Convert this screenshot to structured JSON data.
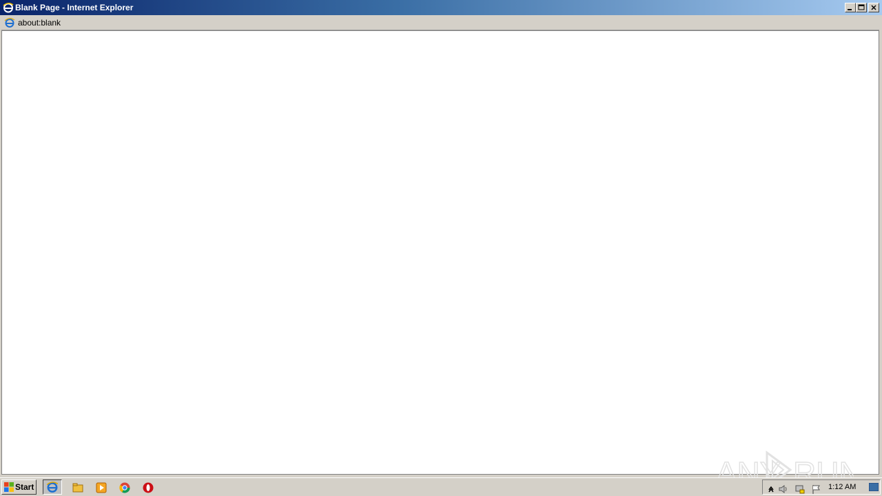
{
  "window": {
    "title": "Blank Page - Internet Explorer",
    "address": "about:blank",
    "controls": [
      "minimize",
      "maximize",
      "close"
    ]
  },
  "watermark": {
    "text": "ANY RUN"
  },
  "taskbar": {
    "start_label": "Start",
    "pinned": [
      "internet-explorer-icon",
      "file-explorer-icon",
      "media-player-icon",
      "chrome-icon",
      "opera-icon"
    ],
    "tray": {
      "icons": [
        "show-hidden-icons",
        "volume-icon",
        "network-icon",
        "action-center-flag-icon"
      ],
      "clock": "1:12 AM"
    }
  },
  "colors": {
    "titlebar_start": "#0a246a",
    "titlebar_end": "#a6caf0",
    "chrome": "#d4d0c8",
    "content": "#ffffff"
  }
}
